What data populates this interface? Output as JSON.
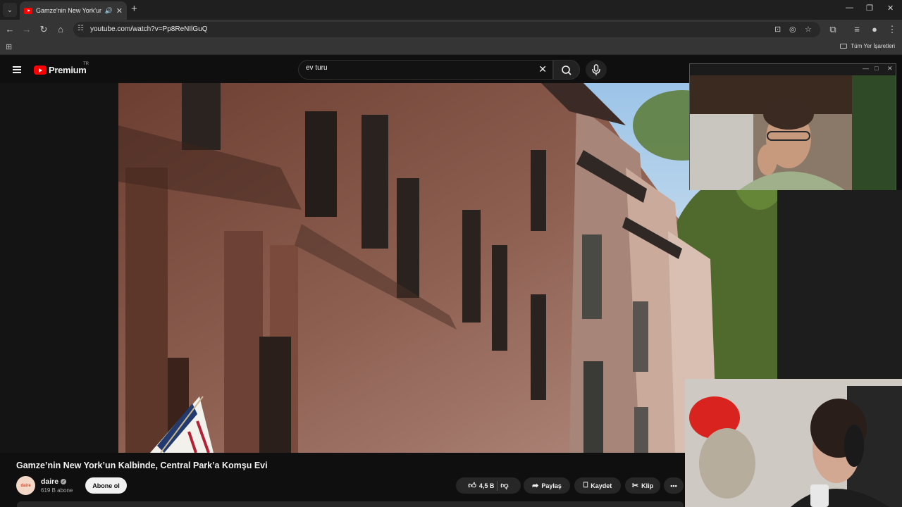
{
  "browser": {
    "tab_title": "Gamze'nin New York'un Kalbinde, Central Park'a Komşu Evi - YouTube",
    "url": "youtube.com/watch?v=Pp8ReNIlGuQ",
    "bookmarks_all": "Tüm Yer İşaretleri",
    "icons": [
      "back-icon",
      "forward-icon",
      "reload-icon",
      "home-icon",
      "site-info-icon",
      "install-icon",
      "eye-off-icon",
      "star-icon",
      "extensions-icon",
      "queue-icon",
      "profile-icon",
      "more-icon"
    ]
  },
  "youtube": {
    "logo_text": "Premium",
    "country": "TR",
    "search_value": "ev turu"
  },
  "video": {
    "title": "Gamze’nin New York’un Kalbinde, Central Park’a Komşu Evi",
    "channel": "daire",
    "channel_avatar_text": "daire",
    "subscribers": "619 B abone",
    "subscribe_label": "Abone ol",
    "likes": "4,5 B",
    "share_label": "Paylaş",
    "save_label": "Kaydet",
    "clip_label": "Klip",
    "more_label": "•••"
  }
}
